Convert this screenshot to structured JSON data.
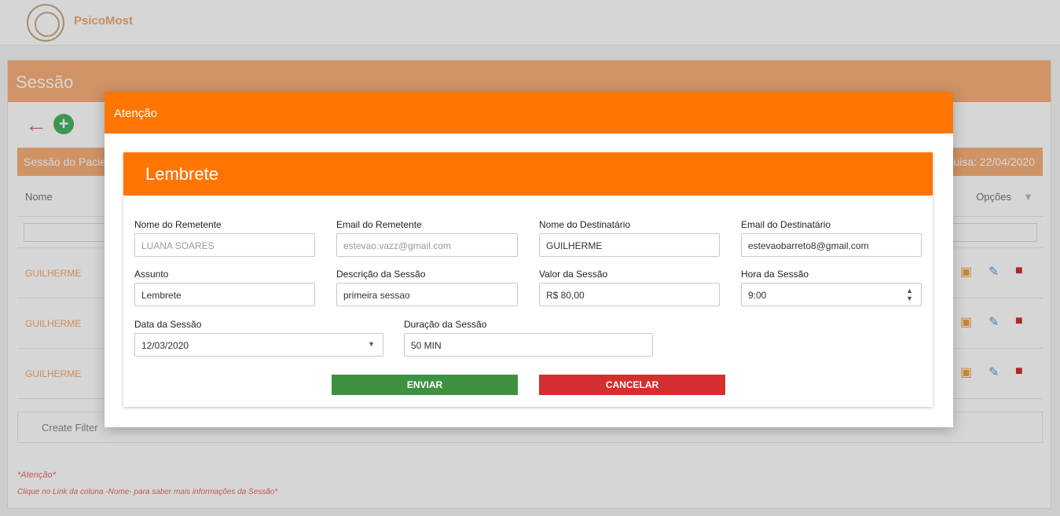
{
  "app": {
    "brand": "PsicoMost"
  },
  "page": {
    "title": "Sessão",
    "grid_title": "Sessão do Paciente",
    "grid_right": "Data da Pesquisa: 22/04/2020",
    "columns": {
      "nome": "Nome",
      "opcoes": "Opções"
    },
    "rows": [
      {
        "nome": "GUILHERME"
      },
      {
        "nome": "GUILHERME"
      },
      {
        "nome": "GUILHERME"
      }
    ],
    "create_filter": "Create Filter",
    "attention_title": "*Atenção*",
    "attention_text": "Clique no Link da coluna -Nome- para saber mais informações da Sessão*"
  },
  "modal": {
    "title": "Atenção",
    "card_title": "Lembrete",
    "fields": {
      "remetente_nome": {
        "label": "Nome do Remetente",
        "value": "LUANA SOARES"
      },
      "remetente_email": {
        "label": "Email do Remetente",
        "value": "estevao.vazz@gmail.com"
      },
      "destinatario_nome": {
        "label": "Nome do Destinatário",
        "value": "GUILHERME"
      },
      "destinatario_email": {
        "label": "Email do Destinatário",
        "value": "estevaobarreto8@gmail.com"
      },
      "assunto": {
        "label": "Assunto",
        "value": "Lembrete"
      },
      "descricao": {
        "label": "Descrição da Sessão",
        "value": "primeira sessao"
      },
      "valor": {
        "label": "Valor da Sessão",
        "value": "R$ 80,00"
      },
      "hora": {
        "label": "Hora da Sessão",
        "value": "9:00"
      },
      "data": {
        "label": "Data da Sessão",
        "value": "12/03/2020"
      },
      "duracao": {
        "label": "Duração da Sessão",
        "value": "50 MIN"
      }
    },
    "buttons": {
      "send": "ENVIAR",
      "cancel": "CANCELAR"
    }
  },
  "colors": {
    "modal_header": "#ff7504",
    "send_button": "#3f9142",
    "cancel_button": "#d32f2f",
    "page_header": "#f7b07a"
  },
  "icons": [
    "brain-logo-icon",
    "back-arrow-icon",
    "add-circle-icon",
    "filter-icon",
    "calendar-add-icon",
    "edit-pencil-icon",
    "trash-icon",
    "chevron-down-icon",
    "spinner-icon"
  ]
}
